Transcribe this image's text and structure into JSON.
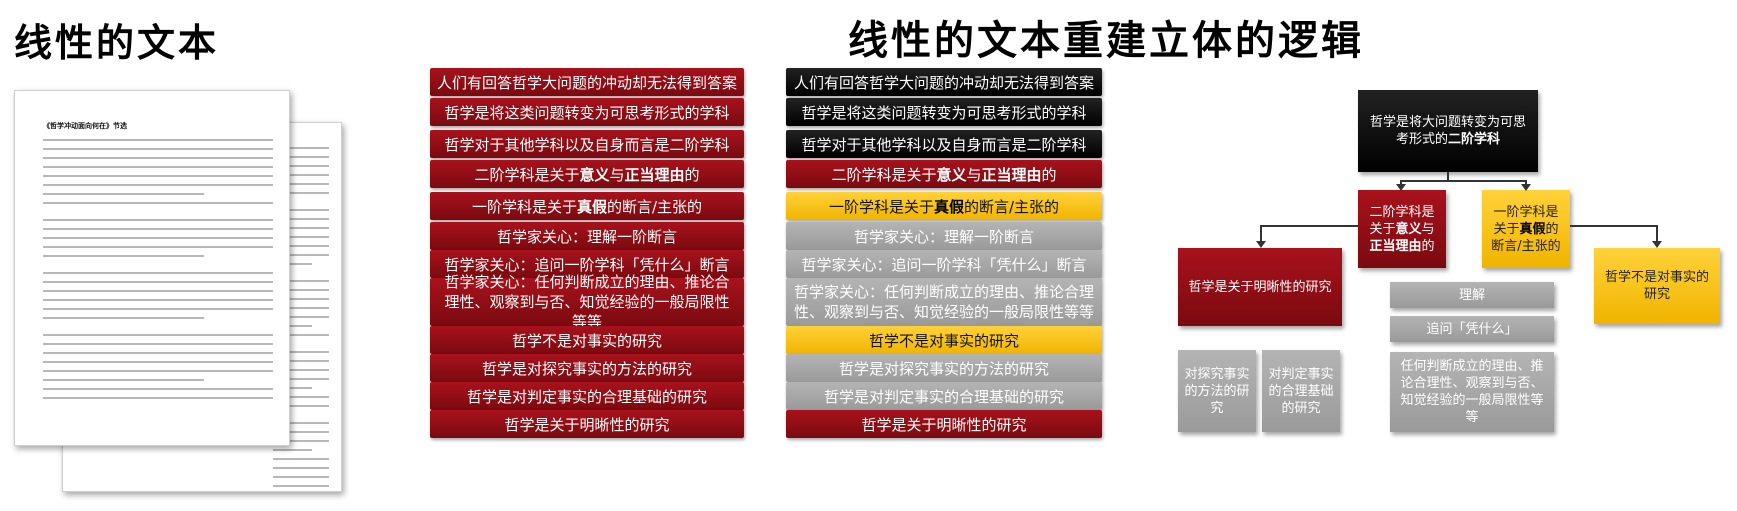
{
  "titles": {
    "left": "线性的文本",
    "right": "线性的文本重建立体的逻辑"
  },
  "document": {
    "title": "《哲学冲动面向何在》节选"
  },
  "statements": [
    {
      "pre": "人们有回答哲学大问题的冲动却无法得到答案"
    },
    {
      "pre": "哲学是将这类问题转变为可思考形式的学科"
    },
    {
      "pre": "哲学对于其他学科以及自身而言是二阶学科"
    },
    {
      "pre": "二阶学科是关于",
      "b1": "意义",
      "mid": "与",
      "b2": "正当理由",
      "post": "的"
    },
    {
      "pre": "一阶学科是关于",
      "b1": "真假",
      "mid": "的断言/主张的"
    },
    {
      "pre": "哲学家关心：理解一阶断言"
    },
    {
      "pre": "哲学家关心：追问一阶学科「凭什么」断言"
    },
    {
      "pre": "哲学家关心：任何判断成立的理由、推论合理性、观察到与否、知觉经验的一般局限性等等"
    },
    {
      "pre": "哲学不是对事实的研究"
    },
    {
      "pre": "哲学是对探究事实的方法的研究"
    },
    {
      "pre": "哲学是对判定事实的合理基础的研究"
    },
    {
      "pre": "哲学是关于明晰性的研究"
    }
  ],
  "tree": {
    "root": {
      "pre": "哲学是将大问题转变为可思考形式的",
      "b": "二阶学科"
    },
    "second_order": {
      "pre": "二阶学科是关于",
      "b1": "意义",
      "mid": "与",
      "b2": "正当理由",
      "post": "的"
    },
    "first_order": {
      "pre": "一阶学科是关于",
      "b1": "真假",
      "post": "的断言/主张的"
    },
    "clarity": "哲学是关于明晰性的研究",
    "not_fact": "哲学不是对事实的研究",
    "methods": "对探究事实的方法的研究",
    "basis": "对判定事实的合理基础的研究",
    "understand": "理解",
    "ask": "追问「凭什么」",
    "reasons": "任何判断成立的理由、推论合理性、观察到与否、知觉经验的一般局限性等等"
  },
  "colors": {
    "red": "#8b0e15",
    "black": "#000000",
    "yellow": "#f5c518",
    "gray": "#a6a6a6"
  }
}
